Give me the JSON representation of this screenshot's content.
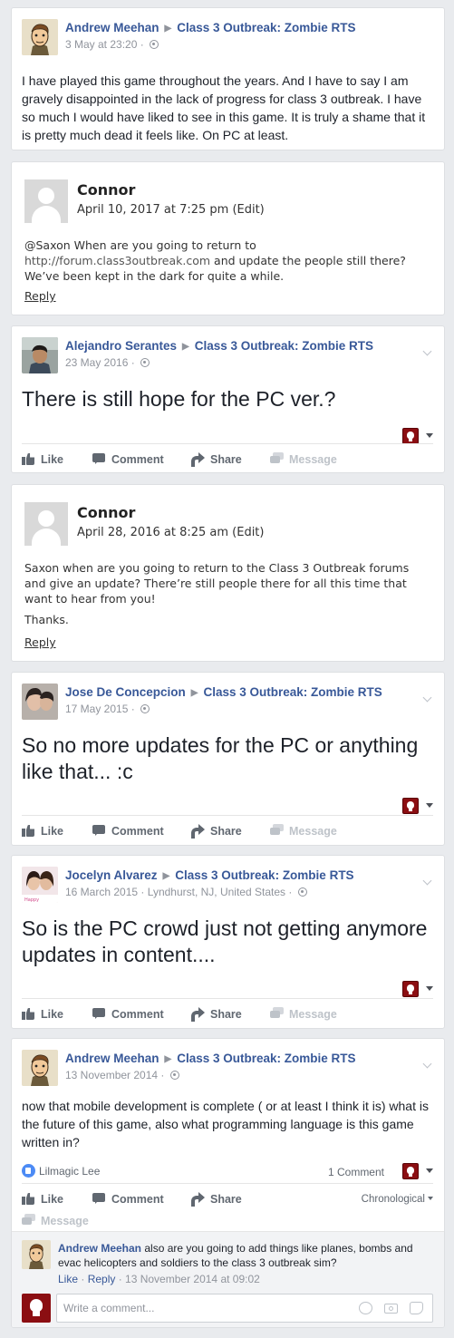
{
  "colors": {
    "link": "#385898",
    "meta": "#90949c",
    "background": "#e9ebee"
  },
  "posts": [
    {
      "author": "Andrew Meehan",
      "group": "Class 3 Outbreak: Zombie RTS",
      "time": "3 May at 23:20 · ",
      "text": "I have played this game throughout the years. And I have to say I am gravely disappointed in the lack of progress for class 3 outbreak. I have so much I would have liked to see in this game. It is truly a shame that it is pretty much dead it feels like. On PC at least."
    },
    {
      "author": "Alejandro Serantes",
      "group": "Class 3 Outbreak: Zombie RTS",
      "time": "23 May 2016 · ",
      "text": "There is still hope for the PC ver.?"
    },
    {
      "author": "Jose De Concepcion",
      "group": "Class 3 Outbreak: Zombie RTS",
      "time": "17 May 2015 · ",
      "text": "So no more updates for the PC or anything like that... :c"
    },
    {
      "author": "Jocelyn Alvarez",
      "group": "Class 3 Outbreak: Zombie RTS",
      "time": "16 March 2015 · Lyndhurst, NJ, United States · ",
      "text": "So is the PC crowd just not getting anymore updates in content...."
    },
    {
      "author": "Andrew Meehan",
      "group": "Class 3 Outbreak: Zombie RTS",
      "time": "13 November 2014 · ",
      "text": "now that mobile development is complete ( or at least I think it is) what is the future of this game, also what programming language is this game written in?",
      "liker": "Lilmagic Lee",
      "comment_count": "1 Comment",
      "sort": "Chronological",
      "comment": {
        "author": "Andrew Meehan",
        "text": " also are you going to add things like planes, bombs and evac helicopters and soldiers to the class 3 outbreak sim?",
        "like": "Like",
        "reply": "Reply",
        "time": " · 13 November 2014 at 09:02"
      },
      "write_placeholder": "Write a comment..."
    }
  ],
  "blog_comments": [
    {
      "author": "Connor",
      "date": "April 10, 2017 at 7:25 pm  (Edit)",
      "text_pre": "@Saxon When are you going to return to ",
      "link": "http://forum.class3outbreak.com",
      "text_post": " and update the people still there? We’ve been kept in the dark for quite a while.",
      "reply": "Reply"
    },
    {
      "author": "Connor",
      "date": "April 28, 2016 at 8:25 am  (Edit)",
      "text": "Saxon when are you going to return to the Class 3 Outbreak forums and give an update? There’re still people there for all this time that want to hear from you!",
      "thanks": "Thanks.",
      "reply": "Reply"
    }
  ],
  "actions": {
    "like": "Like",
    "comment": "Comment",
    "share": "Share",
    "message": "Message"
  },
  "icons": {
    "globe": "globe-icon",
    "chevron": "chevron-down-icon",
    "game": "zombie-skull-icon"
  }
}
